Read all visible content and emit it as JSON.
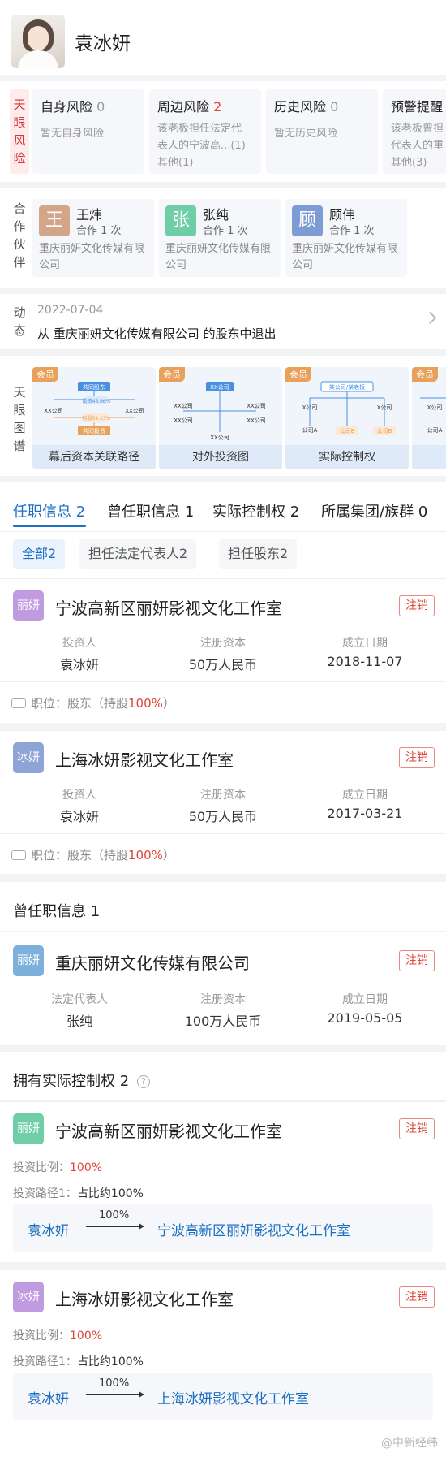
{
  "profile": {
    "name": "袁冰妍"
  },
  "risk": {
    "label": [
      "天",
      "眼",
      "风",
      "险"
    ],
    "cards": [
      {
        "title": "自身风险",
        "count": "0",
        "desc": "暂无自身风险",
        "desc2": ""
      },
      {
        "title": "周边风险",
        "count": "2",
        "desc": "该老板担任法定代",
        "desc2": "表人的宁波高...(1)",
        "desc3": "其他(1)"
      },
      {
        "title": "历史风险",
        "count": "0",
        "desc": "暂无历史风险",
        "desc2": ""
      },
      {
        "title": "预警提醒",
        "count": "",
        "desc": "该老板曾担",
        "desc2": "代表人的重",
        "desc3": "其他(3)"
      }
    ]
  },
  "partners": {
    "label": [
      "合",
      "作",
      "伙",
      "伴"
    ],
    "items": [
      {
        "avatar": "王",
        "name": "王炜",
        "count": "合作 1 次",
        "company": "重庆丽妍文化传媒有限公司",
        "color": "#d4a689"
      },
      {
        "avatar": "张",
        "name": "张纯",
        "count": "合作 1 次",
        "company": "重庆丽妍文化传媒有限公司",
        "color": "#6fcda7"
      },
      {
        "avatar": "顾",
        "name": "顾伟",
        "count": "合作 1 次",
        "company": "重庆丽妍文化传媒有限公司",
        "color": "#7e9cd4"
      }
    ]
  },
  "dynamic": {
    "label": [
      "动",
      "态"
    ],
    "date": "2022-07-04",
    "text": "从 重庆丽妍文化传媒有限公司 的股东中退出"
  },
  "graph": {
    "label": [
      "天",
      "眼",
      "图",
      "谱"
    ],
    "tag": "会员",
    "cards": [
      {
        "caption": "幕后资本关联路径",
        "n1": "共同股东",
        "n2": "XX公司",
        "n3": "XX公司",
        "n4": "投资45.66%",
        "n5": "持股54.13%",
        "n6": "共同投资"
      },
      {
        "caption": "对外投资图",
        "n1": "XX公司",
        "n2": "XX公司",
        "n3": "XX公司",
        "n4": "XX公司",
        "n5": "XX公司",
        "n6": "XX公司"
      },
      {
        "caption": "实际控制权",
        "n1": "某公司/某老板",
        "n2": "X公司",
        "n3": "X公司",
        "n4": "公司A",
        "n5": "公司B",
        "n6": "公司B"
      },
      {
        "caption": "",
        "n1": "X公司",
        "n2": "公司A"
      }
    ]
  },
  "tabs": [
    {
      "label": "任职信息",
      "count": "2"
    },
    {
      "label": "曾任职信息",
      "count": "1"
    },
    {
      "label": "实际控制权",
      "count": "2"
    },
    {
      "label": "所属集团/族群",
      "count": "0"
    }
  ],
  "chips": [
    "全部2",
    "担任法定代表人2",
    "担任股东2"
  ],
  "current": [
    {
      "logo": "丽妍",
      "logo_color": "#c19be0",
      "name": "宁波高新区丽妍影视文化工作室",
      "status": "注销",
      "h1": "投资人",
      "v1": "袁冰妍",
      "h2": "注册资本",
      "v2": "50万人民币",
      "h3": "成立日期",
      "v3": "2018-11-07",
      "role": "职位：股东（持股",
      "pct": "100%",
      "role_end": "）"
    },
    {
      "logo": "冰妍",
      "logo_color": "#8ea3d6",
      "name": "上海冰妍影视文化工作室",
      "status": "注销",
      "h1": "投资人",
      "v1": "袁冰妍",
      "h2": "注册资本",
      "v2": "50万人民币",
      "h3": "成立日期",
      "v3": "2017-03-21",
      "role": "职位：股东（持股",
      "pct": "100%",
      "role_end": "）"
    }
  ],
  "former": {
    "title": "曾任职信息 1",
    "item": {
      "logo": "丽妍",
      "logo_color": "#7eb0dc",
      "name": "重庆丽妍文化传媒有限公司",
      "status": "注销",
      "h1": "法定代表人",
      "v1": "张纯",
      "h2": "注册资本",
      "v2": "100万人民币",
      "h3": "成立日期",
      "v3": "2019-05-05"
    }
  },
  "control": {
    "title": "拥有实际控制权 2",
    "ratio_label": "投资比例：",
    "path_label": "投资路径1：",
    "items": [
      {
        "logo": "丽妍",
        "logo_color": "#6fcda7",
        "name": "宁波高新区丽妍影视文化工作室",
        "status": "注销",
        "ratio": "100%",
        "path": "占比约100%",
        "from": "袁冰妍",
        "pct": "100%",
        "to": "宁波高新区丽妍影视文化工作室"
      },
      {
        "logo": "冰妍",
        "logo_color": "#c19be0",
        "name": "上海冰妍影视文化工作室",
        "status": "注销",
        "ratio": "100%",
        "path": "占比约100%",
        "from": "袁冰妍",
        "pct": "100%",
        "to": "上海冰妍影视文化工作室"
      }
    ]
  },
  "watermark": "@中新经纬"
}
